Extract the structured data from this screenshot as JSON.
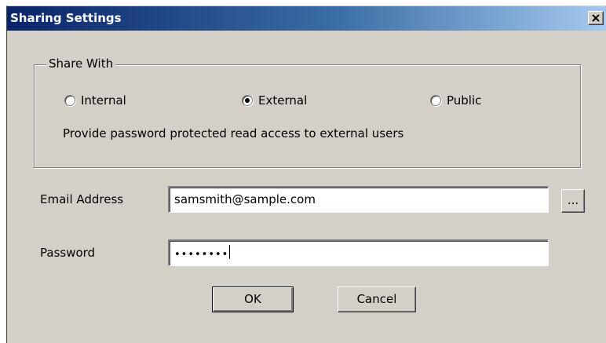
{
  "dialog": {
    "title": "Sharing Settings",
    "close_icon": "close-icon"
  },
  "share_with": {
    "legend": "Share With",
    "options": [
      {
        "label": "Internal",
        "selected": false
      },
      {
        "label": "External",
        "selected": true
      },
      {
        "label": "Public",
        "selected": false
      }
    ],
    "description": "Provide password protected read access to external users"
  },
  "email": {
    "label": "Email Address",
    "value": "samsmith@sample.com",
    "browse_label": "..."
  },
  "password": {
    "label": "Password",
    "masked_value": "••••••••"
  },
  "buttons": {
    "ok": "OK",
    "cancel": "Cancel"
  },
  "colors": {
    "title_bar_start": "#0a246a",
    "title_bar_end": "#a6caf0",
    "dialog_face": "#d4d0c8"
  }
}
